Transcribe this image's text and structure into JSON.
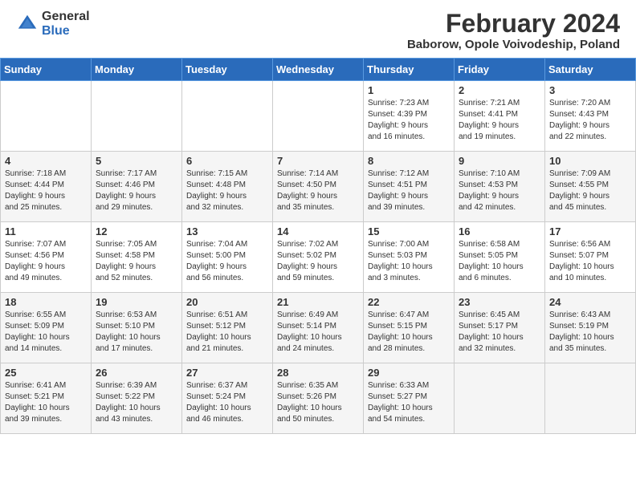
{
  "header": {
    "logo_general": "General",
    "logo_blue": "Blue",
    "month_year": "February 2024",
    "location": "Baborow, Opole Voivodeship, Poland"
  },
  "weekdays": [
    "Sunday",
    "Monday",
    "Tuesday",
    "Wednesday",
    "Thursday",
    "Friday",
    "Saturday"
  ],
  "weeks": [
    [
      {
        "day": "",
        "info": ""
      },
      {
        "day": "",
        "info": ""
      },
      {
        "day": "",
        "info": ""
      },
      {
        "day": "",
        "info": ""
      },
      {
        "day": "1",
        "info": "Sunrise: 7:23 AM\nSunset: 4:39 PM\nDaylight: 9 hours\nand 16 minutes."
      },
      {
        "day": "2",
        "info": "Sunrise: 7:21 AM\nSunset: 4:41 PM\nDaylight: 9 hours\nand 19 minutes."
      },
      {
        "day": "3",
        "info": "Sunrise: 7:20 AM\nSunset: 4:43 PM\nDaylight: 9 hours\nand 22 minutes."
      }
    ],
    [
      {
        "day": "4",
        "info": "Sunrise: 7:18 AM\nSunset: 4:44 PM\nDaylight: 9 hours\nand 25 minutes."
      },
      {
        "day": "5",
        "info": "Sunrise: 7:17 AM\nSunset: 4:46 PM\nDaylight: 9 hours\nand 29 minutes."
      },
      {
        "day": "6",
        "info": "Sunrise: 7:15 AM\nSunset: 4:48 PM\nDaylight: 9 hours\nand 32 minutes."
      },
      {
        "day": "7",
        "info": "Sunrise: 7:14 AM\nSunset: 4:50 PM\nDaylight: 9 hours\nand 35 minutes."
      },
      {
        "day": "8",
        "info": "Sunrise: 7:12 AM\nSunset: 4:51 PM\nDaylight: 9 hours\nand 39 minutes."
      },
      {
        "day": "9",
        "info": "Sunrise: 7:10 AM\nSunset: 4:53 PM\nDaylight: 9 hours\nand 42 minutes."
      },
      {
        "day": "10",
        "info": "Sunrise: 7:09 AM\nSunset: 4:55 PM\nDaylight: 9 hours\nand 45 minutes."
      }
    ],
    [
      {
        "day": "11",
        "info": "Sunrise: 7:07 AM\nSunset: 4:56 PM\nDaylight: 9 hours\nand 49 minutes."
      },
      {
        "day": "12",
        "info": "Sunrise: 7:05 AM\nSunset: 4:58 PM\nDaylight: 9 hours\nand 52 minutes."
      },
      {
        "day": "13",
        "info": "Sunrise: 7:04 AM\nSunset: 5:00 PM\nDaylight: 9 hours\nand 56 minutes."
      },
      {
        "day": "14",
        "info": "Sunrise: 7:02 AM\nSunset: 5:02 PM\nDaylight: 9 hours\nand 59 minutes."
      },
      {
        "day": "15",
        "info": "Sunrise: 7:00 AM\nSunset: 5:03 PM\nDaylight: 10 hours\nand 3 minutes."
      },
      {
        "day": "16",
        "info": "Sunrise: 6:58 AM\nSunset: 5:05 PM\nDaylight: 10 hours\nand 6 minutes."
      },
      {
        "day": "17",
        "info": "Sunrise: 6:56 AM\nSunset: 5:07 PM\nDaylight: 10 hours\nand 10 minutes."
      }
    ],
    [
      {
        "day": "18",
        "info": "Sunrise: 6:55 AM\nSunset: 5:09 PM\nDaylight: 10 hours\nand 14 minutes."
      },
      {
        "day": "19",
        "info": "Sunrise: 6:53 AM\nSunset: 5:10 PM\nDaylight: 10 hours\nand 17 minutes."
      },
      {
        "day": "20",
        "info": "Sunrise: 6:51 AM\nSunset: 5:12 PM\nDaylight: 10 hours\nand 21 minutes."
      },
      {
        "day": "21",
        "info": "Sunrise: 6:49 AM\nSunset: 5:14 PM\nDaylight: 10 hours\nand 24 minutes."
      },
      {
        "day": "22",
        "info": "Sunrise: 6:47 AM\nSunset: 5:15 PM\nDaylight: 10 hours\nand 28 minutes."
      },
      {
        "day": "23",
        "info": "Sunrise: 6:45 AM\nSunset: 5:17 PM\nDaylight: 10 hours\nand 32 minutes."
      },
      {
        "day": "24",
        "info": "Sunrise: 6:43 AM\nSunset: 5:19 PM\nDaylight: 10 hours\nand 35 minutes."
      }
    ],
    [
      {
        "day": "25",
        "info": "Sunrise: 6:41 AM\nSunset: 5:21 PM\nDaylight: 10 hours\nand 39 minutes."
      },
      {
        "day": "26",
        "info": "Sunrise: 6:39 AM\nSunset: 5:22 PM\nDaylight: 10 hours\nand 43 minutes."
      },
      {
        "day": "27",
        "info": "Sunrise: 6:37 AM\nSunset: 5:24 PM\nDaylight: 10 hours\nand 46 minutes."
      },
      {
        "day": "28",
        "info": "Sunrise: 6:35 AM\nSunset: 5:26 PM\nDaylight: 10 hours\nand 50 minutes."
      },
      {
        "day": "29",
        "info": "Sunrise: 6:33 AM\nSunset: 5:27 PM\nDaylight: 10 hours\nand 54 minutes."
      },
      {
        "day": "",
        "info": ""
      },
      {
        "day": "",
        "info": ""
      }
    ]
  ]
}
